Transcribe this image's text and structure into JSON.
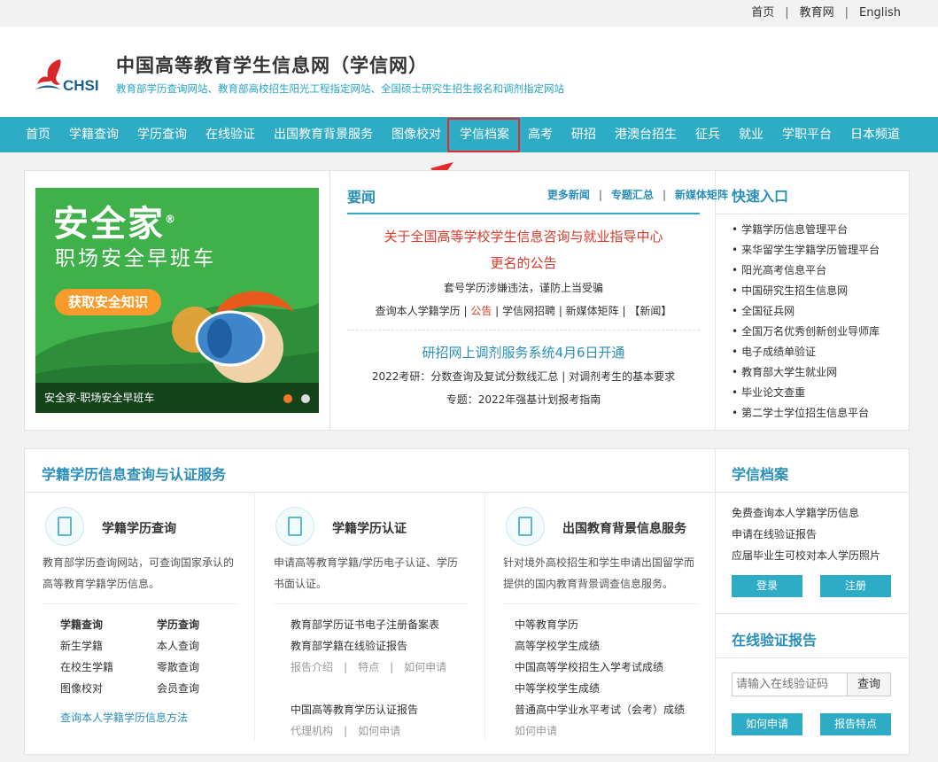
{
  "toplinks": {
    "home": "首页",
    "edu": "教育网",
    "english": "English"
  },
  "header": {
    "logo_text": "CHSI",
    "title": "中国高等教育学生信息网（学信网）",
    "subtitle": "教育部学历查询网站、教育部高校招生阳光工程指定网站、全国硕士研究生招生报名和调剂指定网站"
  },
  "nav": [
    "首页",
    "学籍查询",
    "学历查询",
    "在线验证",
    "出国教育背景服务",
    "图像校对",
    "学信档案",
    "高考",
    "研招",
    "港澳台招生",
    "征兵",
    "就业",
    "学职平台",
    "日本频道"
  ],
  "banner": {
    "title": "安全家",
    "reg": "®",
    "subtitle": "职场安全早班车",
    "button": "获取安全知识",
    "caption": "安全家-职场安全早班车"
  },
  "news": {
    "heading": "要闻",
    "links": [
      "更多新闻",
      "专题汇总",
      "新媒体矩阵"
    ],
    "headline1_line1": "关于全国高等学校学生信息咨询与就业指导中心",
    "headline1_line2": "更名的公告",
    "row1": "套号学历涉嫌违法，谨防上当受骗",
    "row2_a": "查询本人学籍学历 | ",
    "row2_b": "公告",
    "row2_c": " | 学信网招聘 | 新媒体矩阵 | 【新闻】",
    "headline2": "研招网上调剂服务系统4月6日开通",
    "row3": "2022考研：分数查询及复试分数线汇总 | 对调剂考生的基本要求",
    "row4": "专题：2022年强基计划报考指南"
  },
  "quick": {
    "title": "快速入口",
    "items": [
      "学籍学历信息管理平台",
      "来华留学生学籍学历管理平台",
      "阳光高考信息平台",
      "中国研究生招生信息网",
      "全国征兵网",
      "全国万名优秀创新创业导师库",
      "电子成绩单验证",
      "教育部大学生就业网",
      "毕业论文查重",
      "第二学士学位招生信息平台"
    ]
  },
  "services": {
    "title": "学籍学历信息查询与认证服务",
    "col1": {
      "title": "学籍学历查询",
      "desc1": "教育部学历查询网站，可查询国家承认的",
      "desc2": "高等教育学籍学历信息。",
      "links_left": [
        "学籍查询",
        "新生学籍",
        "在校生学籍",
        "图像校对"
      ],
      "links_right": [
        "学历查询",
        "本人查询",
        "零散查询",
        "会员查询"
      ],
      "method": "查询本人学籍学历信息方法"
    },
    "col2": {
      "title": "学籍学历认证",
      "desc1": "申请高等教育学籍/学历电子认证、学历",
      "desc2": "书面认证。",
      "link1": "教育部学历证书电子注册备案表",
      "link2": "教育部学籍在线验证报告",
      "sub1": [
        "报告介绍",
        "特点",
        "如何申请"
      ],
      "link3": "中国高等教育学历认证报告",
      "sub2": [
        "代理机构",
        "如何申请"
      ],
      "sep": "|"
    },
    "col3": {
      "title": "出国教育背景信息服务",
      "desc1": "针对境外高校招生和学生申请出国留学而",
      "desc2": "提供的国内教育背景调查信息服务。",
      "links": [
        "中等教育学历",
        "高等学校学生成绩",
        "中国高等学校招生入学考试成绩",
        "中等学校学生成绩",
        "普通高中学业水平考试（会考）成绩"
      ],
      "apply": "如何申请"
    }
  },
  "archive": {
    "title": "学信档案",
    "items": [
      "免费查询本人学籍学历信息",
      "申请在线验证报告",
      "应届毕业生可校对本人学历照片"
    ],
    "login": "登录",
    "register": "注册"
  },
  "verify": {
    "title": "在线验证报告",
    "placeholder": "请输入在线验证码",
    "query": "查询",
    "how": "如何申请",
    "features": "报告特点"
  },
  "colors": {
    "accent": "#2eacc6",
    "link_blue": "#2a8fb8",
    "alert_red": "#d93a2b",
    "highlight_box": "#e5292c",
    "banner_green": "#3fb04a"
  }
}
